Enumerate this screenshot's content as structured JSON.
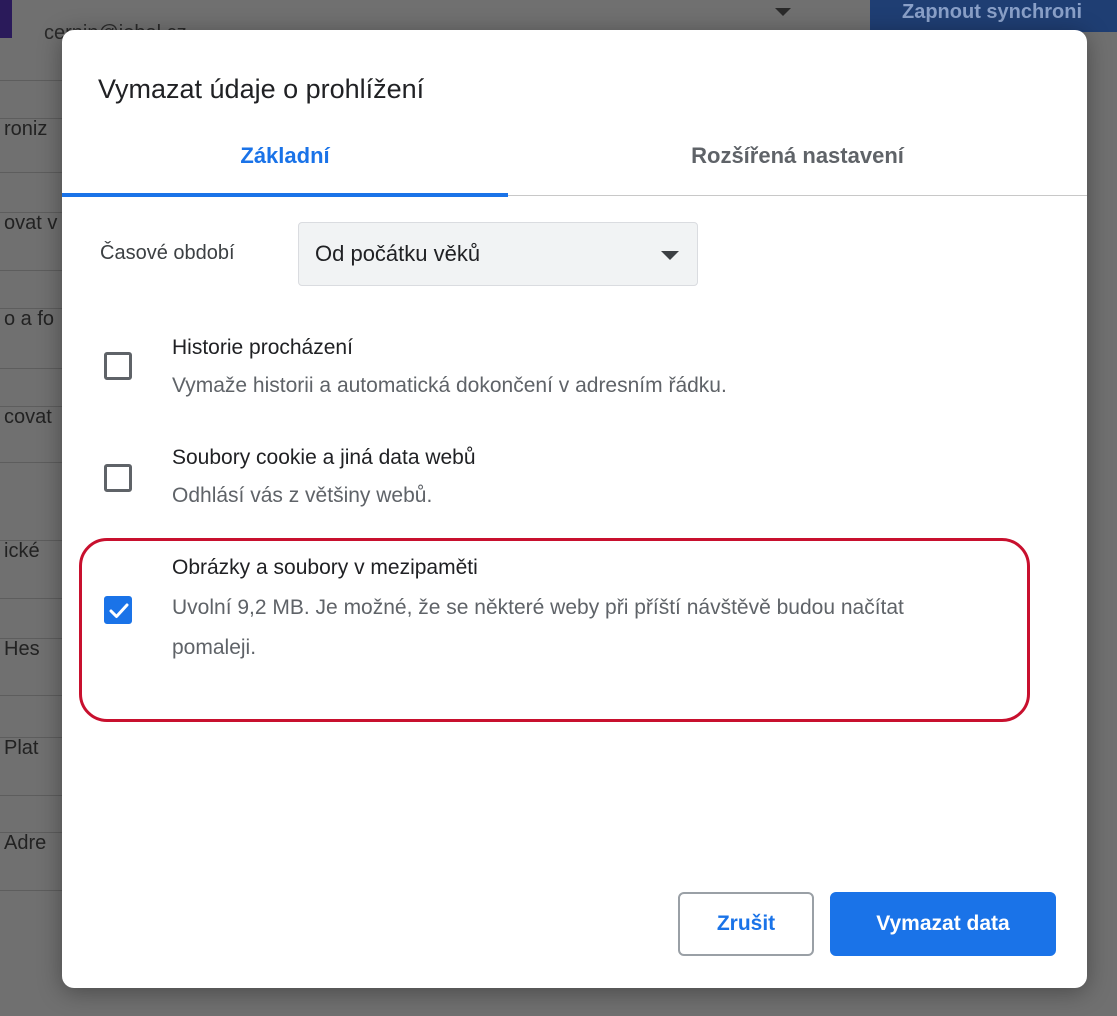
{
  "background": {
    "account_text": "cernin@iobal.cz",
    "sync_button_label": "Zapnout synchroni",
    "rows": [
      "roniz",
      "ovat v",
      "o a fo",
      "covat",
      "ické",
      "Hes",
      "Plat",
      "Adre"
    ]
  },
  "dialog": {
    "title": "Vymazat údaje o prohlížení",
    "tabs": [
      {
        "label": "Základní",
        "active": true
      },
      {
        "label": "Rozšířená nastavení",
        "active": false
      }
    ],
    "time_range": {
      "label": "Časové období",
      "value": "Od počátku věků"
    },
    "options": [
      {
        "title": "Historie procházení",
        "description": "Vymaže historii a automatická dokončení v adresním řádku.",
        "checked": false
      },
      {
        "title": "Soubory cookie a jiná data webů",
        "description": "Odhlásí vás z většiny webů.",
        "checked": false
      },
      {
        "title": "Obrázky a soubory v mezipaměti",
        "description": "Uvolní 9,2 MB. Je možné, že se některé weby při příští návštěvě budou načítat pomaleji.",
        "checked": true
      }
    ],
    "cancel_label": "Zrušit",
    "clear_label": "Vymazat data"
  },
  "colors": {
    "accent": "#1a73e8",
    "highlight": "#c8102e",
    "overlay": "#707070"
  }
}
